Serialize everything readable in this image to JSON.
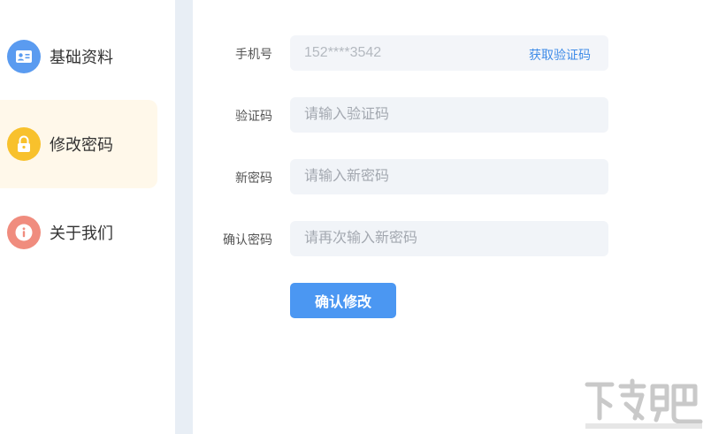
{
  "sidebar": {
    "items": [
      {
        "label": "基础资料",
        "icon": "profile-card-icon",
        "color": "#5a9bf0",
        "active": false
      },
      {
        "label": "修改密码",
        "icon": "lock-icon",
        "color": "#f8c12c",
        "active": true
      },
      {
        "label": "关于我们",
        "icon": "info-icon",
        "color": "#f08c7e",
        "active": false
      }
    ]
  },
  "form": {
    "phone": {
      "label": "手机号",
      "value": "152****3542",
      "action": "获取验证码"
    },
    "code": {
      "label": "验证码",
      "placeholder": "请输入验证码"
    },
    "new_password": {
      "label": "新密码",
      "placeholder": "请输入新密码"
    },
    "confirm_password": {
      "label": "确认密码",
      "placeholder": "请再次输入新密码"
    },
    "submit_label": "确认修改"
  },
  "colors": {
    "accent": "#4b97f2",
    "active_bg": "#fff8ea",
    "field_bg": "#f1f4f8",
    "divider": "#e8eef5"
  }
}
